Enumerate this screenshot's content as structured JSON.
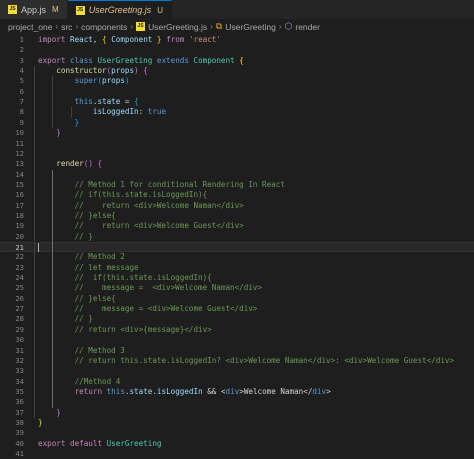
{
  "tabs": [
    {
      "label": "App.js",
      "badge": "M",
      "active": false
    },
    {
      "label": "UserGreeting.js",
      "badge": "U",
      "active": true
    }
  ],
  "breadcrumb": {
    "items": [
      "project_one",
      "src",
      "components",
      "UserGreeting.js",
      "UserGreeting",
      "render"
    ]
  },
  "editor": {
    "current_line": 21,
    "lines": [
      {
        "n": "1",
        "indent": 0,
        "tokens": [
          [
            "kw",
            "import"
          ],
          [
            "pun",
            " "
          ],
          [
            "var",
            "React"
          ],
          [
            "pun",
            ", "
          ],
          [
            "b1",
            "{"
          ],
          [
            "pun",
            " "
          ],
          [
            "var",
            "Component"
          ],
          [
            "pun",
            " "
          ],
          [
            "b1",
            "}"
          ],
          [
            "pun",
            " "
          ],
          [
            "kw",
            "from"
          ],
          [
            "pun",
            " "
          ],
          [
            "str",
            "'react'"
          ]
        ]
      },
      {
        "n": "2",
        "indent": 0,
        "tokens": []
      },
      {
        "n": "3",
        "indent": 0,
        "tokens": [
          [
            "kw",
            "export"
          ],
          [
            "pun",
            " "
          ],
          [
            "st",
            "class"
          ],
          [
            "pun",
            " "
          ],
          [
            "cls",
            "UserGreeting"
          ],
          [
            "pun",
            " "
          ],
          [
            "st",
            "extends"
          ],
          [
            "pun",
            " "
          ],
          [
            "cls",
            "Component"
          ],
          [
            "pun",
            " "
          ],
          [
            "b1",
            "{"
          ]
        ]
      },
      {
        "n": "4",
        "indent": 1,
        "tokens": [
          [
            "fn",
            "constructor"
          ],
          [
            "b2",
            "("
          ],
          [
            "var",
            "props"
          ],
          [
            "b2",
            ")"
          ],
          [
            "pun",
            " "
          ],
          [
            "b2",
            "{"
          ]
        ]
      },
      {
        "n": "5",
        "indent": 2,
        "tokens": [
          [
            "st",
            "super"
          ],
          [
            "b3",
            "("
          ],
          [
            "var",
            "props"
          ],
          [
            "b3",
            ")"
          ]
        ]
      },
      {
        "n": "6",
        "indent": 0,
        "tokens": []
      },
      {
        "n": "7",
        "indent": 2,
        "tokens": [
          [
            "st",
            "this"
          ],
          [
            "pun",
            "."
          ],
          [
            "var",
            "state"
          ],
          [
            "pun",
            " = "
          ],
          [
            "b3",
            "{"
          ]
        ]
      },
      {
        "n": "8",
        "indent": 3,
        "tokens": [
          [
            "var",
            "isLoggedIn"
          ],
          [
            "pun",
            ": "
          ],
          [
            "st",
            "true"
          ]
        ]
      },
      {
        "n": "9",
        "indent": 2,
        "tokens": [
          [
            "b3",
            "}"
          ]
        ]
      },
      {
        "n": "10",
        "indent": 1,
        "tokens": [
          [
            "b2",
            "}"
          ]
        ]
      },
      {
        "n": "11",
        "indent": 0,
        "tokens": []
      },
      {
        "n": "12",
        "indent": 0,
        "tokens": []
      },
      {
        "n": "13",
        "indent": 1,
        "tokens": [
          [
            "fn",
            "render"
          ],
          [
            "b2",
            "("
          ],
          [
            "b2",
            ")"
          ],
          [
            "pun",
            " "
          ],
          [
            "b2",
            "{"
          ]
        ]
      },
      {
        "n": "14",
        "indent": 0,
        "tokens": []
      },
      {
        "n": "15",
        "indent": 2,
        "tokens": [
          [
            "com",
            "// Method 1 for conditional Rendering In React"
          ]
        ]
      },
      {
        "n": "16",
        "indent": 2,
        "tokens": [
          [
            "com",
            "// if(this.state.isLoggedIn){"
          ]
        ]
      },
      {
        "n": "17",
        "indent": 2,
        "tokens": [
          [
            "com",
            "//    return <div>Welcome Naman</div>"
          ]
        ]
      },
      {
        "n": "18",
        "indent": 2,
        "tokens": [
          [
            "com",
            "// }else{"
          ]
        ]
      },
      {
        "n": "19",
        "indent": 2,
        "tokens": [
          [
            "com",
            "//    return <div>Welcome Guest</div>"
          ]
        ]
      },
      {
        "n": "20",
        "indent": 2,
        "tokens": [
          [
            "com",
            "// }"
          ]
        ]
      },
      {
        "n": "21",
        "indent": 0,
        "tokens": []
      },
      {
        "n": "22",
        "indent": 2,
        "tokens": [
          [
            "com",
            "// Method 2"
          ]
        ]
      },
      {
        "n": "23",
        "indent": 2,
        "tokens": [
          [
            "com",
            "// let message"
          ]
        ]
      },
      {
        "n": "24",
        "indent": 2,
        "tokens": [
          [
            "com",
            "//  if(this.state.isLoggedIn){"
          ]
        ]
      },
      {
        "n": "25",
        "indent": 2,
        "tokens": [
          [
            "com",
            "//    message =  <div>Welcome Naman</div>"
          ]
        ]
      },
      {
        "n": "26",
        "indent": 2,
        "tokens": [
          [
            "com",
            "// }else{"
          ]
        ]
      },
      {
        "n": "27",
        "indent": 2,
        "tokens": [
          [
            "com",
            "//    message = <div>Welcome Guest</div>"
          ]
        ]
      },
      {
        "n": "28",
        "indent": 2,
        "tokens": [
          [
            "com",
            "// }"
          ]
        ]
      },
      {
        "n": "29",
        "indent": 2,
        "tokens": [
          [
            "com",
            "// return <div>{message}</div>"
          ]
        ]
      },
      {
        "n": "30",
        "indent": 0,
        "tokens": []
      },
      {
        "n": "31",
        "indent": 2,
        "tokens": [
          [
            "com",
            "// Method 3"
          ]
        ]
      },
      {
        "n": "32",
        "indent": 2,
        "tokens": [
          [
            "com",
            "// return this.state.isLoggedIn? <div>Welcome Naman</div>: <div>Welcome Guest</div>"
          ]
        ]
      },
      {
        "n": "33",
        "indent": 0,
        "tokens": []
      },
      {
        "n": "34",
        "indent": 2,
        "tokens": [
          [
            "com",
            "//Method 4"
          ]
        ]
      },
      {
        "n": "35",
        "indent": 2,
        "tokens": [
          [
            "kw",
            "return"
          ],
          [
            "pun",
            " "
          ],
          [
            "st",
            "this"
          ],
          [
            "pun",
            "."
          ],
          [
            "var",
            "state"
          ],
          [
            "pun",
            "."
          ],
          [
            "var",
            "isLoggedIn"
          ],
          [
            "pun",
            " && "
          ],
          [
            "pun",
            "<"
          ],
          [
            "tag",
            "div"
          ],
          [
            "pun",
            ">"
          ],
          [
            "txt",
            "Welcome Naman"
          ],
          [
            "pun",
            "</"
          ],
          [
            "tag",
            "div"
          ],
          [
            "pun",
            ">"
          ]
        ]
      },
      {
        "n": "36",
        "indent": 0,
        "tokens": []
      },
      {
        "n": "37",
        "indent": 1,
        "tokens": [
          [
            "b2",
            "}"
          ]
        ]
      },
      {
        "n": "38",
        "indent": 0,
        "tokens": [
          [
            "b1",
            "}"
          ]
        ]
      },
      {
        "n": "39",
        "indent": 0,
        "tokens": []
      },
      {
        "n": "40",
        "indent": 0,
        "tokens": [
          [
            "kw",
            "export"
          ],
          [
            "pun",
            " "
          ],
          [
            "kw",
            "default"
          ],
          [
            "pun",
            " "
          ],
          [
            "cls",
            "UserGreeting"
          ]
        ]
      },
      {
        "n": "41",
        "indent": 0,
        "tokens": []
      }
    ]
  }
}
